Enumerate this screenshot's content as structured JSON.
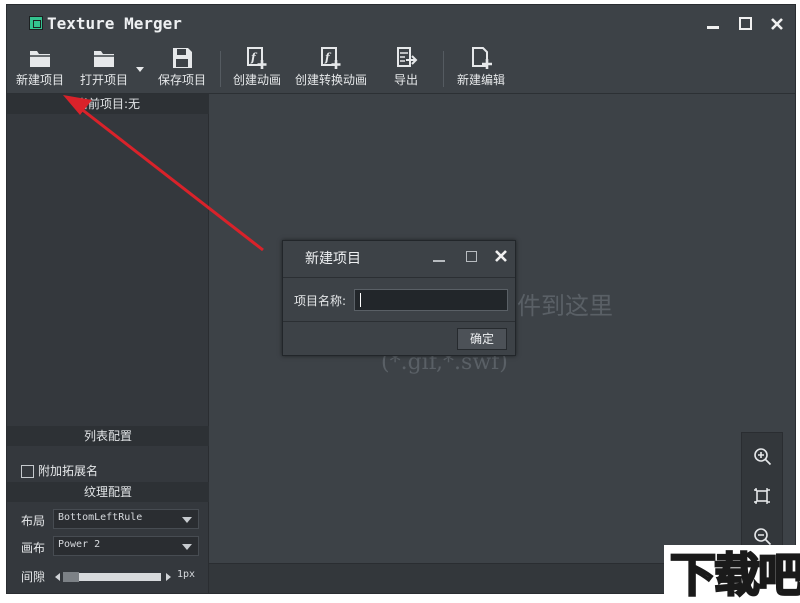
{
  "window": {
    "title": "Texture Merger"
  },
  "toolbar": {
    "new_project": "新建项目",
    "open_project": "打开项目",
    "save_project": "保存项目",
    "create_animation": "创建动画",
    "create_transition": "创建转换动画",
    "export": "导出",
    "new_editor": "新建编辑"
  },
  "left_panel": {
    "current_project_header": "当前项目:无",
    "list_config_header": "列表配置",
    "append_ext_label": "附加拓展名",
    "append_ext_checked": false,
    "texture_config_header": "纹理配置",
    "layout_label": "布局",
    "layout_value": "BottomLeftRule",
    "canvas_label": "画布",
    "canvas_value": "Power 2",
    "spacing_label": "间隙",
    "spacing_value": "1px"
  },
  "canvas": {
    "drop_hint_line1": "件到这里",
    "drop_hint_line2": "(*.gif,*.swf)"
  },
  "dialog": {
    "title": "新建项目",
    "field_label": "项目名称:",
    "field_value": "",
    "ok_label": "确定"
  },
  "watermark": {
    "text": "下载吧"
  },
  "colors": {
    "annotation_arrow": "#d9222a",
    "logo": "#34c38f"
  },
  "icons": [
    "app-logo-icon",
    "minimize-icon",
    "maximize-icon",
    "close-icon",
    "folder-icon",
    "save-icon",
    "flash-plus-icon",
    "export-icon",
    "file-plus-icon",
    "zoom-in-icon",
    "fit-icon",
    "zoom-out-icon"
  ]
}
